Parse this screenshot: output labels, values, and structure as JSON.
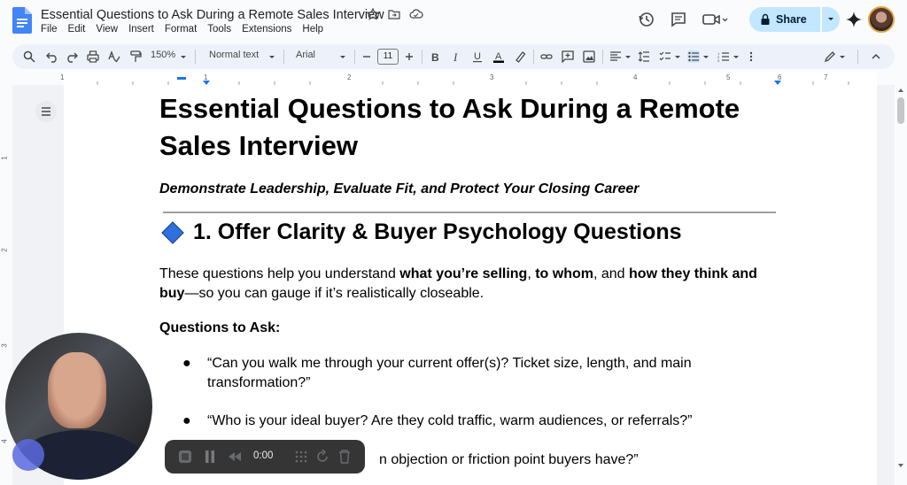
{
  "document": {
    "title": "Essential Questions to Ask During a Remote Sales Interview"
  },
  "menu": [
    "File",
    "Edit",
    "View",
    "Insert",
    "Format",
    "Tools",
    "Extensions",
    "Help"
  ],
  "header": {
    "share_label": "Share"
  },
  "toolbar": {
    "zoom": "150%",
    "style": "Normal text",
    "font": "Arial",
    "font_size": "11"
  },
  "ruler": {
    "numbers": [
      "1",
      "1",
      "2",
      "3",
      "4",
      "5",
      "6",
      "7"
    ]
  },
  "content": {
    "heading": "Essential Questions to Ask During a Remote Sales Interview",
    "subtitle": "Demonstrate Leadership, Evaluate Fit, and Protect Your Closing Career",
    "section_heading": "1. Offer Clarity & Buyer Psychology Questions",
    "para_part1": "These questions help you understand ",
    "para_bold1": "what you’re selling",
    "para_part2": ", ",
    "para_bold2": "to whom",
    "para_part3": ", and ",
    "para_bold3": "how they think and buy",
    "para_part4": "—so you can gauge if it’s realistically closeable.",
    "questions_label": "Questions to Ask:",
    "bullets": [
      "“Can you walk me through your current offer(s)? Ticket size, length, and main transformation?”",
      "“Who is your ideal buyer? Are they cold traffic, warm audiences, or referrals?”",
      "n objection or friction point buyers have?”"
    ]
  },
  "recorder": {
    "time": "0:00"
  },
  "colors": {
    "share_bg": "#c2e7ff",
    "toolbar_bg": "#edf2fa",
    "diamond": "#2f6fde"
  }
}
